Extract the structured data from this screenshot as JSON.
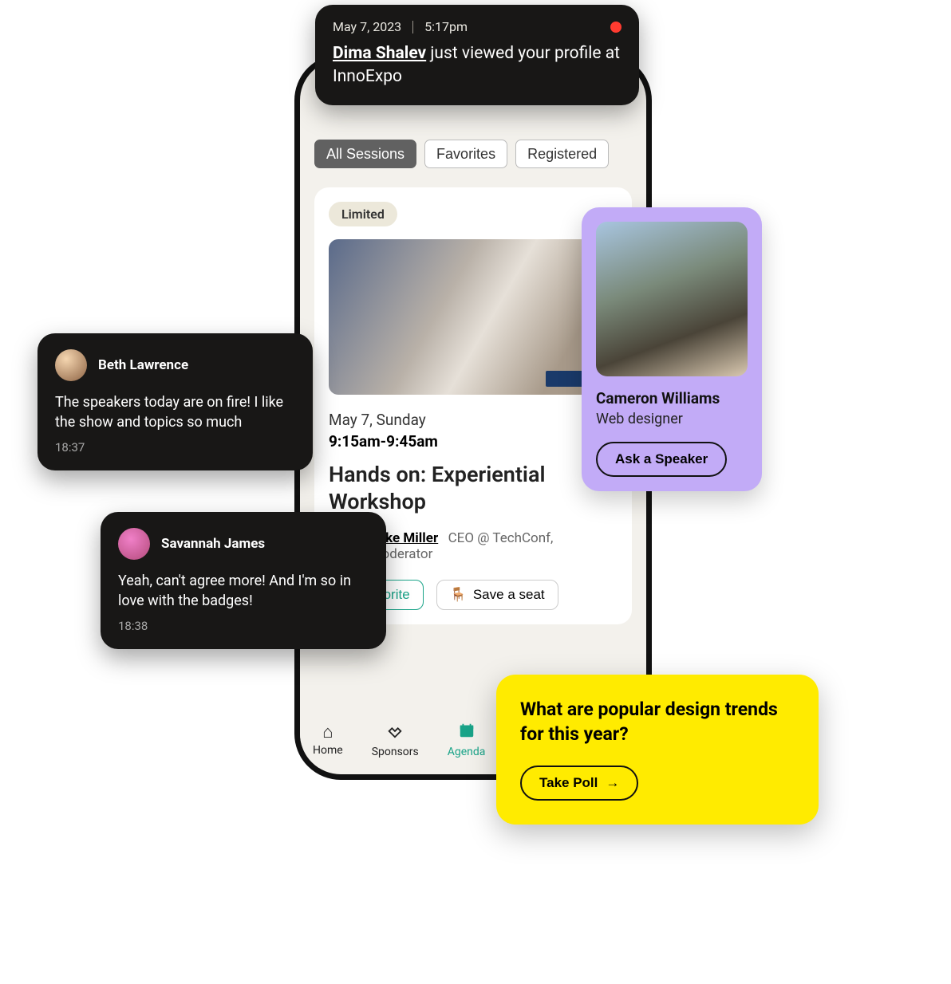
{
  "notification": {
    "date": "May 7, 2023",
    "time": "5:17pm",
    "user": "Dima Shalev",
    "rest": " just viewed your profile at InnoExpo"
  },
  "filters": {
    "tabs": [
      "All Sessions",
      "Favorites",
      "Registered"
    ],
    "active_index": 0
  },
  "session": {
    "limited_badge": "Limited",
    "date": "May 7, Sunday",
    "time": "9:15am-9:45am",
    "title": "Hands on: Experiential Workshop",
    "speaker": {
      "name": "Mike Miller",
      "role": "CEO @ TechConf, Moderator"
    },
    "actions": {
      "favorite": "Favorite",
      "save_seat": "Save a seat"
    }
  },
  "nav": {
    "items": [
      {
        "label": "Home"
      },
      {
        "label": "Sponsors"
      },
      {
        "label": "Agenda"
      }
    ],
    "active_index": 2
  },
  "chats": [
    {
      "name": "Beth Lawrence",
      "msg": "The speakers today are on fire! I like the show and topics so much",
      "time": "18:37"
    },
    {
      "name": "Savannah James",
      "msg": "Yeah, can't agree more! And I'm so in love with the badges!",
      "time": "18:38"
    }
  ],
  "speaker_card": {
    "name": "Cameron Williams",
    "role": "Web designer",
    "cta": "Ask a Speaker"
  },
  "poll": {
    "question": "What are popular design trends for this year?",
    "cta": "Take Poll"
  }
}
